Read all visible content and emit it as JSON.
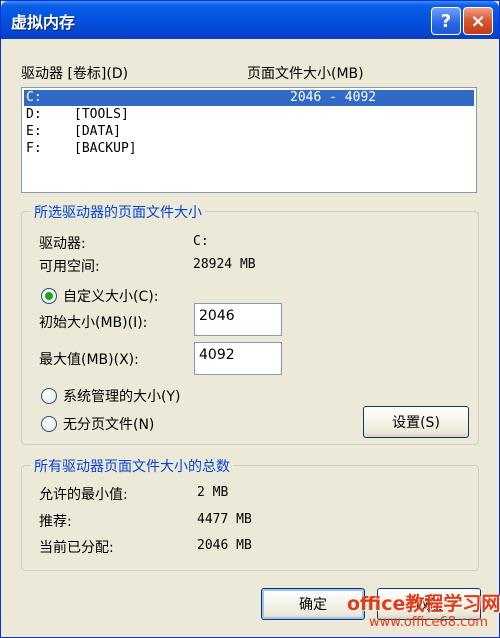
{
  "window": {
    "title": "虚拟内存",
    "help_label": "?",
    "close_label": "×"
  },
  "drive_list": {
    "header_drive": "驱动器 [卷标](D)",
    "header_size": "页面文件大小(MB)",
    "rows": [
      {
        "drive": "C:",
        "label": "",
        "size": "2046 - 4092",
        "selected": true
      },
      {
        "drive": "D:",
        "label": "[TOOLS]",
        "size": ""
      },
      {
        "drive": "E:",
        "label": "[DATA]",
        "size": ""
      },
      {
        "drive": "F:",
        "label": "[BACKUP]",
        "size": ""
      }
    ]
  },
  "selected_group": {
    "title": "所选驱动器的页面文件大小",
    "drive_label": "驱动器:",
    "drive_value": "C:",
    "space_label": "可用空间:",
    "space_value": "28924 MB",
    "custom_label": "自定义大小(C):",
    "initial_label": "初始大小(MB)(I):",
    "initial_value": "2046",
    "max_label": "最大值(MB)(X):",
    "max_value": "4092",
    "system_label": "系统管理的大小(Y)",
    "nopaging_label": "无分页文件(N)",
    "set_button": "设置(S)",
    "selected_option": "custom"
  },
  "totals_group": {
    "title": "所有驱动器页面文件大小的总数",
    "min_label": "允许的最小值:",
    "min_value": "2 MB",
    "rec_label": "推荐:",
    "rec_value": "4477 MB",
    "cur_label": "当前已分配:",
    "cur_value": "2046 MB"
  },
  "footer": {
    "ok_button": "确定",
    "cancel_button": "取消"
  },
  "watermark": {
    "line1": "office教程学习网",
    "line2": "www.office68.com"
  },
  "colors": {
    "title_bar": "#0553e0",
    "selection": "#316ac5",
    "group_title": "#0046d5",
    "watermark": "#e03c1a"
  }
}
